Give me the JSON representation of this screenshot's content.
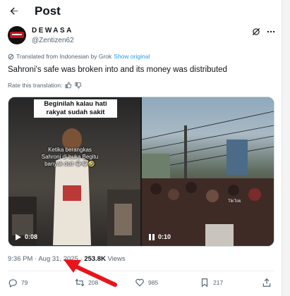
{
  "header": {
    "title": "Post"
  },
  "author": {
    "name": "DEWASA",
    "handle": "@Zentizen62"
  },
  "translation": {
    "note": "Translated from Indonesian by Grok",
    "show_original": "Show original",
    "rate_label": "Rate this translation:"
  },
  "tweet": {
    "text": "Sahroni's safe was broken into and its money was distributed"
  },
  "media": {
    "video1": {
      "caption": "Beginilah kalau hati rakyat sudah sakit",
      "overlay": "Ketika berangkas Sahroni di buka Begitu banyak duit 😂😂🤣",
      "duration": "0:08"
    },
    "video2": {
      "watermark": "TikTok",
      "duration": "0:10"
    }
  },
  "meta": {
    "time": "9:36 PM",
    "date": "Aug 31, 2025",
    "views_count": "253.8K",
    "views_label": "Views",
    "sep": "·"
  },
  "actions": {
    "replies": "79",
    "reposts": "208",
    "likes": "985",
    "bookmarks": "217"
  },
  "colors": {
    "accent": "#1d9bf0",
    "muted": "#536471",
    "arrow": "#e8141a"
  }
}
